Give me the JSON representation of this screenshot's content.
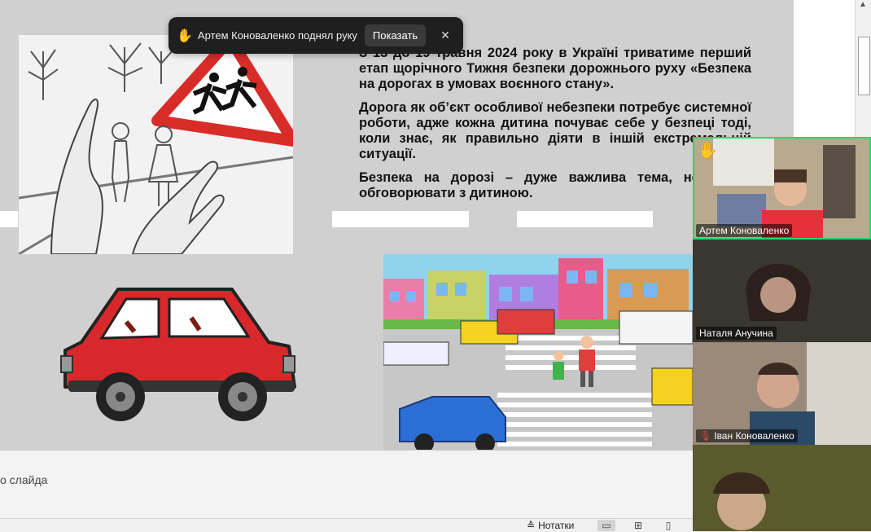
{
  "toast": {
    "hand_icon": "raised-hand-icon",
    "message": "Артем Коноваленко поднял руку",
    "show_button": "Показать",
    "close_icon": "close-icon"
  },
  "slide": {
    "paragraphs": [
      "З 13 до 19 травня 2024 року в Україні триватиме перший етап щорічного Тижня безпеки дорожнього руху «Безпека на дорогах в умовах воєнного стану».",
      "Дорога як об’єкт особливої небезпеки потребує системної роботи, адже кожна дитина почуває себе у безпеці тоді, коли знає, як правильно діяти в іншій екстремальній ситуації.",
      "Безпека на дорозі – дуже важлива тема, необхідно обговорювати з дитиною."
    ]
  },
  "notes": {
    "placeholder": "о слайда"
  },
  "status_bar": {
    "notes_label": "Нотатки"
  },
  "participants": [
    {
      "name": "Артем Коноваленко",
      "hand_raised": true,
      "muted": false
    },
    {
      "name": "Наталя Анучина",
      "hand_raised": false,
      "muted": false
    },
    {
      "name": "Іван Коноваленко",
      "hand_raised": false,
      "muted": true
    },
    {
      "name": "",
      "hand_raised": false,
      "muted": false
    }
  ],
  "colors": {
    "active_speaker": "#23d96b",
    "car_red": "#d8282b"
  }
}
